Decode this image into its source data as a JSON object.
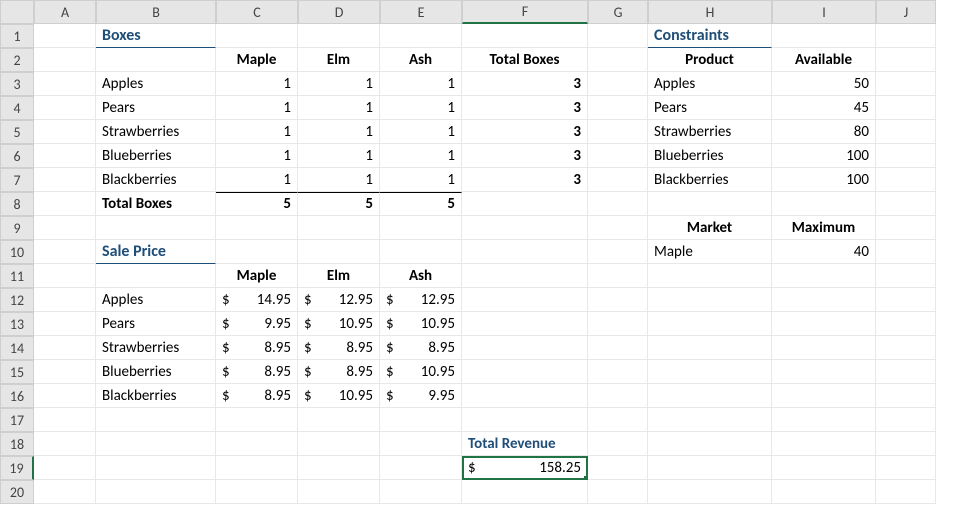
{
  "columns": [
    "",
    "A",
    "B",
    "C",
    "D",
    "E",
    "F",
    "G",
    "H",
    "I",
    "J"
  ],
  "rows": [
    "1",
    "2",
    "3",
    "4",
    "5",
    "6",
    "7",
    "8",
    "9",
    "10",
    "11",
    "12",
    "13",
    "14",
    "15",
    "16",
    "17",
    "18",
    "19",
    "20"
  ],
  "selected": {
    "col": "F",
    "row": "19"
  },
  "titles": {
    "boxes": "Boxes",
    "salePrice": "Sale Price",
    "constraints": "Constraints"
  },
  "boxHeaders": {
    "c": "Maple",
    "d": "Elm",
    "e": "Ash",
    "f": "Total Boxes"
  },
  "products": [
    "Apples",
    "Pears",
    "Strawberries",
    "Blueberries",
    "Blackberries"
  ],
  "boxes": [
    {
      "c": "1",
      "d": "1",
      "e": "1",
      "f": "3"
    },
    {
      "c": "1",
      "d": "1",
      "e": "1",
      "f": "3"
    },
    {
      "c": "1",
      "d": "1",
      "e": "1",
      "f": "3"
    },
    {
      "c": "1",
      "d": "1",
      "e": "1",
      "f": "3"
    },
    {
      "c": "1",
      "d": "1",
      "e": "1",
      "f": "3"
    }
  ],
  "totalBoxesLabel": "Total Boxes",
  "totalBoxes": {
    "c": "5",
    "d": "5",
    "e": "5"
  },
  "priceHeaders": {
    "c": "Maple",
    "d": "Elm",
    "e": "Ash"
  },
  "prices": [
    {
      "c": "14.95",
      "d": "12.95",
      "e": "12.95"
    },
    {
      "c": "9.95",
      "d": "10.95",
      "e": "10.95"
    },
    {
      "c": "8.95",
      "d": "8.95",
      "e": "8.95"
    },
    {
      "c": "8.95",
      "d": "8.95",
      "e": "10.95"
    },
    {
      "c": "8.95",
      "d": "10.95",
      "e": "9.95"
    }
  ],
  "totalRevenueLabel": "Total Revenue",
  "totalRevenueValue": "158.25",
  "currency": "$",
  "constraintsHeaders": {
    "product": "Product",
    "available": "Available"
  },
  "constraints": [
    {
      "product": "Apples",
      "available": "50"
    },
    {
      "product": "Pears",
      "available": "45"
    },
    {
      "product": "Strawberries",
      "available": "80"
    },
    {
      "product": "Blueberries",
      "available": "100"
    },
    {
      "product": "Blackberries",
      "available": "100"
    }
  ],
  "marketHeaders": {
    "market": "Market",
    "maximum": "Maximum"
  },
  "market": {
    "name": "Maple",
    "max": "40"
  },
  "chart_data": {
    "type": "table",
    "title": "Boxes / Sale Price / Constraints",
    "sections": {
      "Boxes": {
        "columns": [
          "Maple",
          "Elm",
          "Ash",
          "Total Boxes"
        ],
        "rows": {
          "Apples": [
            1,
            1,
            1,
            3
          ],
          "Pears": [
            1,
            1,
            1,
            3
          ],
          "Strawberries": [
            1,
            1,
            1,
            3
          ],
          "Blueberries": [
            1,
            1,
            1,
            3
          ],
          "Blackberries": [
            1,
            1,
            1,
            3
          ],
          "Total Boxes": [
            5,
            5,
            5,
            null
          ]
        }
      },
      "Sale Price": {
        "columns": [
          "Maple",
          "Elm",
          "Ash"
        ],
        "rows": {
          "Apples": [
            14.95,
            12.95,
            12.95
          ],
          "Pears": [
            9.95,
            10.95,
            10.95
          ],
          "Strawberries": [
            8.95,
            8.95,
            8.95
          ],
          "Blueberries": [
            8.95,
            8.95,
            10.95
          ],
          "Blackberries": [
            8.95,
            10.95,
            9.95
          ]
        }
      },
      "Total Revenue": 158.25,
      "Constraints": {
        "Product": [
          "Apples",
          "Pears",
          "Strawberries",
          "Blueberries",
          "Blackberries"
        ],
        "Available": [
          50,
          45,
          80,
          100,
          100
        ]
      },
      "Market": {
        "Maple": 40
      }
    }
  }
}
